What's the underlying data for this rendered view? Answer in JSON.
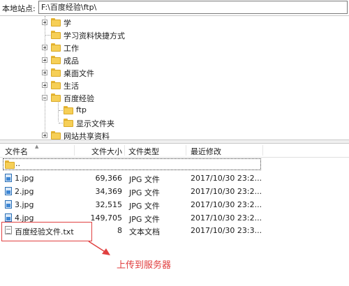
{
  "address": {
    "label": "本地站点:",
    "path": "F:\\百度经验\\ftp\\"
  },
  "tree": {
    "items": [
      {
        "label": "学",
        "expandable": true
      },
      {
        "label": "学习资料快捷方式",
        "expandable": false
      },
      {
        "label": "工作",
        "expandable": true
      },
      {
        "label": "成品",
        "expandable": true
      },
      {
        "label": "桌面文件",
        "expandable": true
      },
      {
        "label": "生活",
        "expandable": true
      },
      {
        "label": "百度经验",
        "expandable": true,
        "expanded": true
      },
      {
        "label": "ftp",
        "expandable": false,
        "child": true
      },
      {
        "label": "显示文件夹",
        "expandable": false,
        "child": true
      },
      {
        "label": "网站共享资料",
        "expandable": true
      }
    ]
  },
  "list": {
    "columns": [
      "文件名",
      "文件大小",
      "文件类型",
      "最近修改"
    ],
    "parent_entry": "..",
    "files": [
      {
        "name": "1.jpg",
        "size": "69,366",
        "type": "JPG 文件",
        "modified": "2017/10/30 23:2...",
        "icon": "jpg-file-icon"
      },
      {
        "name": "2.jpg",
        "size": "34,369",
        "type": "JPG 文件",
        "modified": "2017/10/30 23:2...",
        "icon": "jpg-file-icon"
      },
      {
        "name": "3.jpg",
        "size": "32,515",
        "type": "JPG 文件",
        "modified": "2017/10/30 23:2...",
        "icon": "jpg-file-icon"
      },
      {
        "name": "4.jpg",
        "size": "149,705",
        "type": "JPG 文件",
        "modified": "2017/10/30 23:2...",
        "icon": "jpg-file-icon"
      },
      {
        "name": "百度经验文件.txt",
        "size": "8",
        "type": "文本文档",
        "modified": "2017/10/30 23:3...",
        "icon": "text-file-icon"
      }
    ]
  },
  "annotation": {
    "text": "上传到服务器",
    "color": "#e03c3c"
  }
}
